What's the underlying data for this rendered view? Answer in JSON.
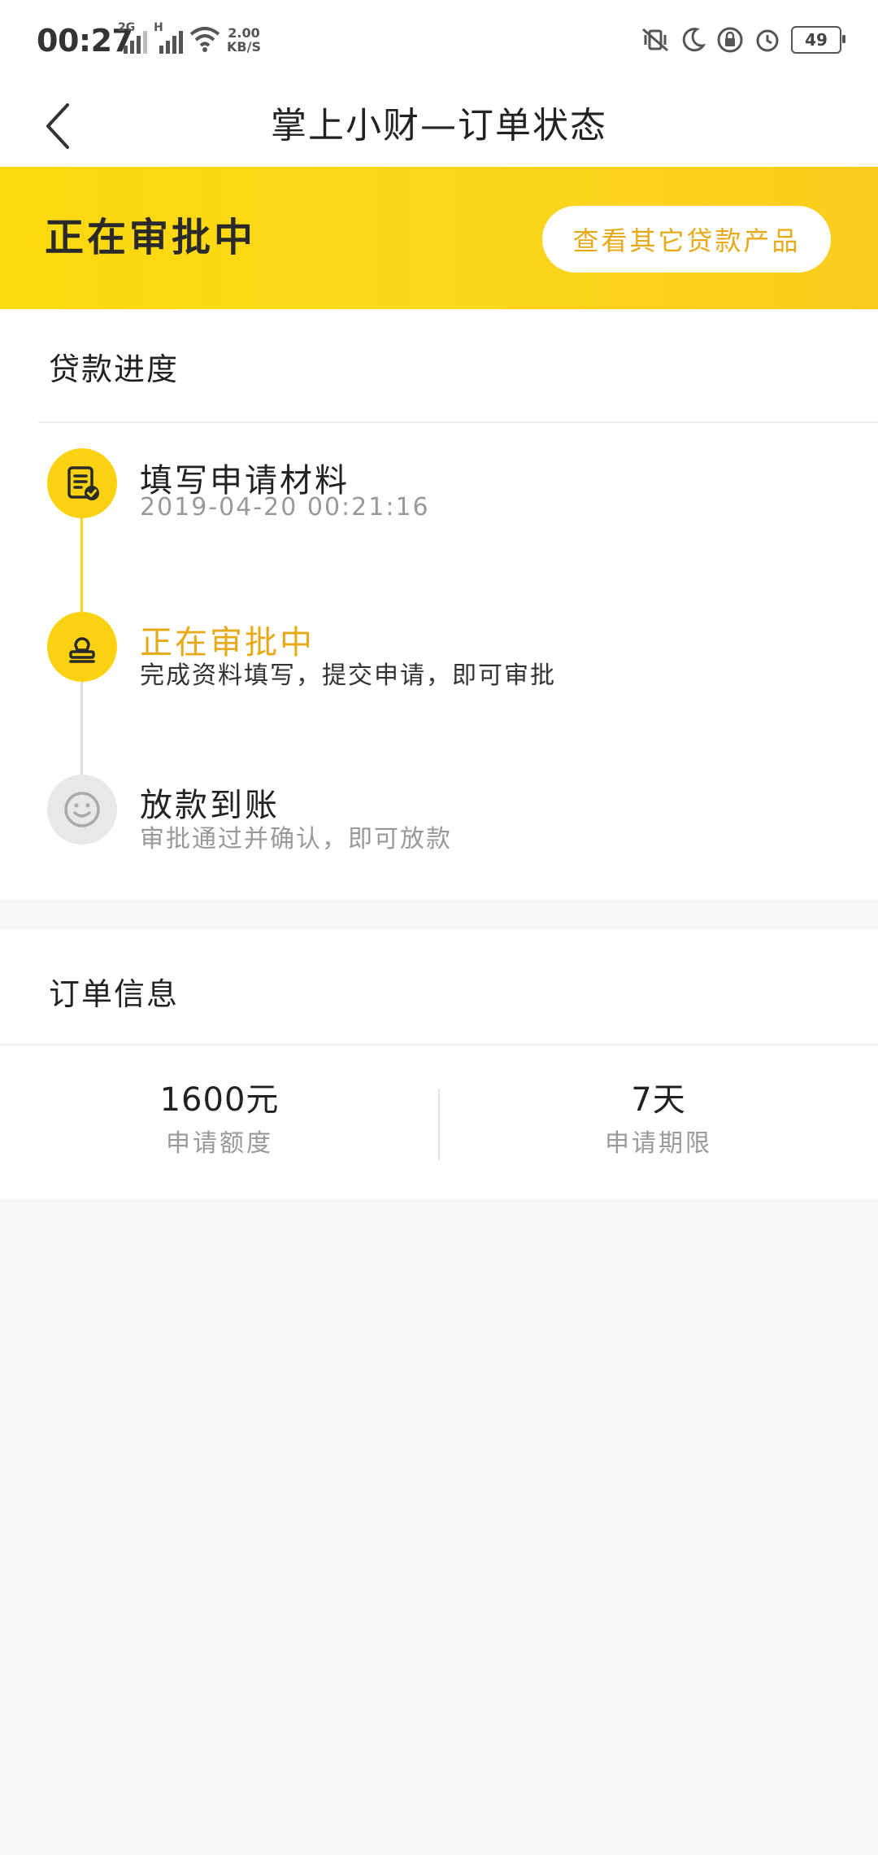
{
  "status_bar": {
    "time": "00:27",
    "signal1_tag": "2G",
    "signal2_tag": "H",
    "speed_value": "2.00",
    "speed_unit": "KB/S",
    "battery": "49"
  },
  "header": {
    "title": "掌上小财—订单状态"
  },
  "banner": {
    "status": "正在审批中",
    "button_label": "查看其它贷款产品"
  },
  "progress": {
    "title": "贷款进度",
    "steps": [
      {
        "title": "填写申请材料",
        "subtitle": "2019-04-20 00:21:16"
      },
      {
        "title": "正在审批中",
        "subtitle": "完成资料填写，提交申请，即可审批"
      },
      {
        "title": "放款到账",
        "subtitle": "审批通过并确认，即可放款"
      }
    ]
  },
  "order": {
    "title": "订单信息",
    "amount_value": "1600元",
    "amount_label": "申请额度",
    "term_value": "7天",
    "term_label": "申请期限"
  },
  "colors": {
    "accent": "#fbd212",
    "accent_text": "#e7a916",
    "muted": "#999999"
  }
}
